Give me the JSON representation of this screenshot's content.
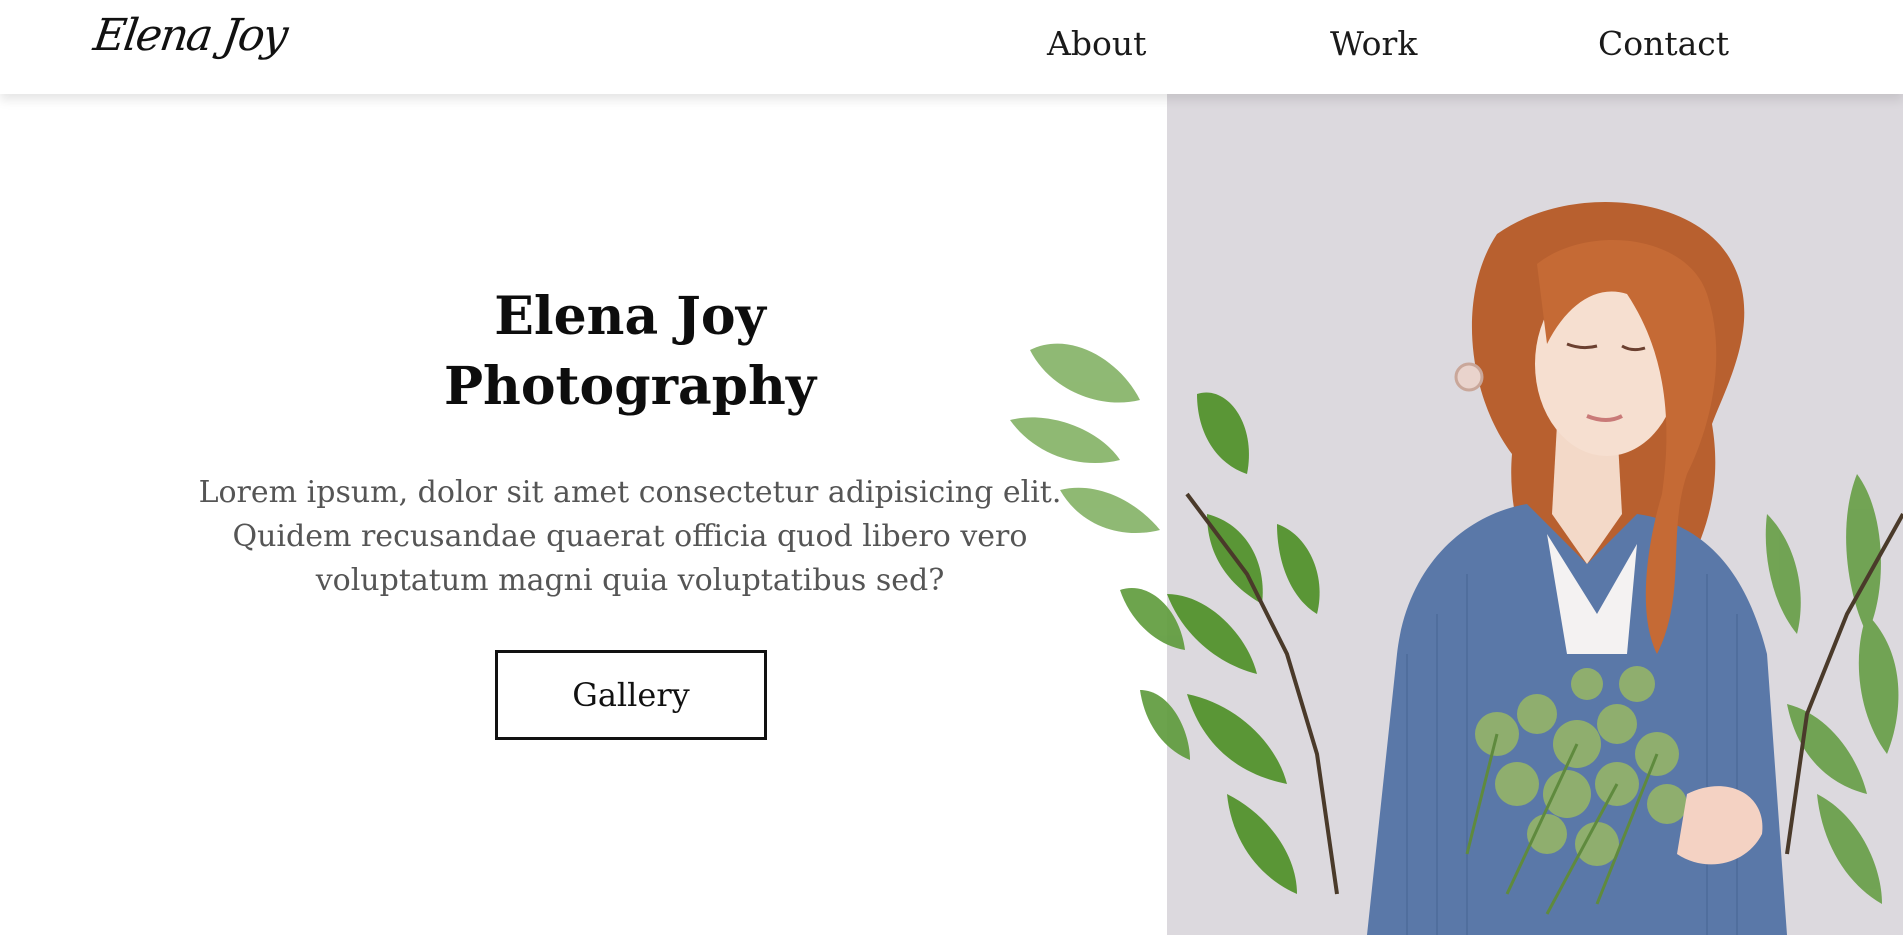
{
  "brand": {
    "logo_text": "Elena Joy"
  },
  "nav": {
    "items": [
      {
        "label": "About"
      },
      {
        "label": "Work"
      },
      {
        "label": "Contact"
      }
    ]
  },
  "hero": {
    "title_line1": "Elena Joy",
    "title_line2": "Photography",
    "description_line1": "Lorem ipsum, dolor sit amet consectetur adipisicing elit.",
    "description_line2": "Quidem recusandae quaerat officia quod libero vero",
    "description_line3": "voluptatum magni quia voluptatibus sed?",
    "cta_label": "Gallery"
  },
  "colors": {
    "photo_background": "#dcd9de",
    "sweater": "#5a78a8",
    "hair": "#b8602f",
    "leaves": "#4f8a32"
  }
}
